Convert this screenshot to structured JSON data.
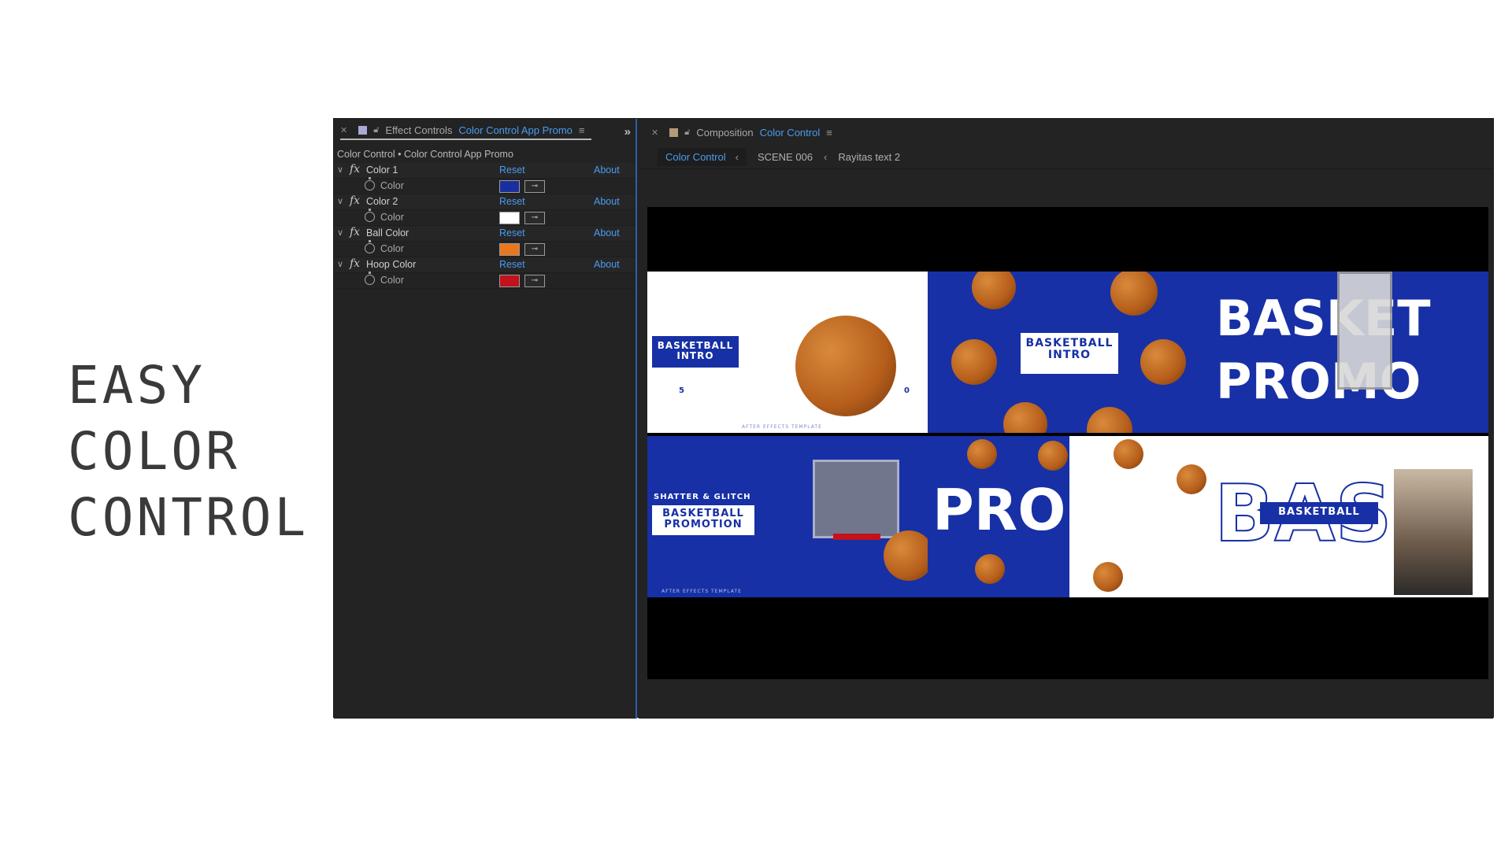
{
  "headline": {
    "lines": [
      "EASY",
      "COLOR",
      "CONTROL"
    ]
  },
  "effect_controls": {
    "tab_prefix": "Effect Controls",
    "tab_layer": "Color Control App Promo",
    "subtitle": "Color Control • Color Control App Promo",
    "reset_label": "Reset",
    "about_label": "About",
    "property_label": "Color",
    "effects": [
      {
        "name": "Color 1",
        "color": "#1a2f9e"
      },
      {
        "name": "Color 2",
        "color": "#ffffff"
      },
      {
        "name": "Ball Color",
        "color": "#e8781e"
      },
      {
        "name": "Hoop Color",
        "color": "#c2121c"
      }
    ]
  },
  "composition": {
    "tab_prefix": "Composition",
    "tab_name": "Color Control",
    "breadcrumbs": [
      "Color Control",
      "SCENE 006",
      "Rayitas text 2"
    ]
  },
  "preview": {
    "basketball_intro_1": "BASKETBALL INTRO",
    "basketball_intro_2": "BASKETBALL INTRO",
    "basket_promo_1": "BASKET",
    "basket_promo_2": "PROMO",
    "shatter_glitch": "SHATTER & GLITCH",
    "basketball_promotion": "BASKETBALL PROMOTION",
    "promo": "PROMO",
    "basketball": "BASKETBALL",
    "corner_5": "5",
    "corner_0": "0",
    "template_note": "AFTER EFFECTS TEMPLATE"
  },
  "colors": {
    "accent": "#4a9cf0",
    "brand_blue": "#1730a5",
    "panel_bg": "#232323"
  }
}
